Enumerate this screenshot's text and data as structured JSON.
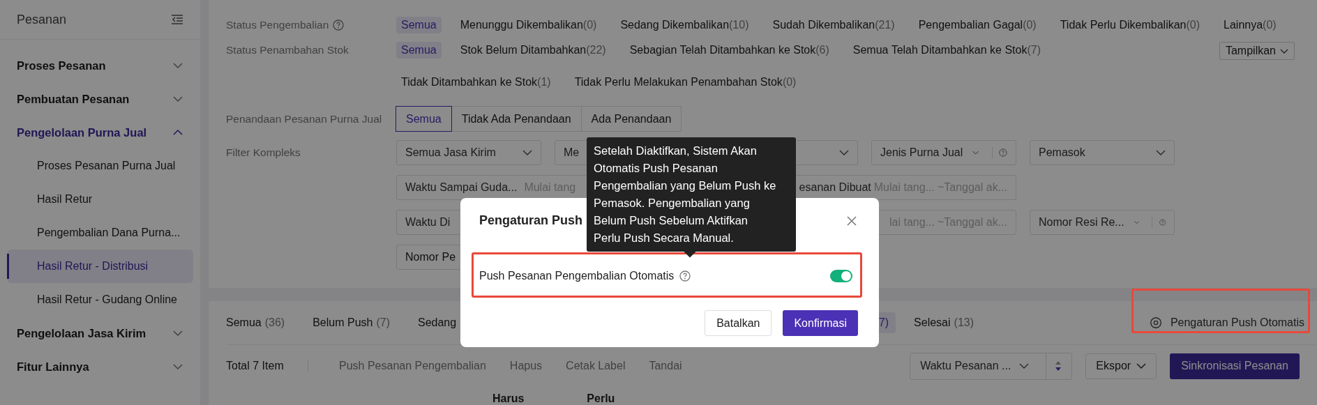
{
  "sidebar": {
    "title": "Pesanan",
    "items": [
      {
        "label": "Proses Pesanan",
        "expanded": false
      },
      {
        "label": "Pembuatan Pesanan",
        "expanded": false
      },
      {
        "label": "Pengelolaan Purna Jual",
        "expanded": true,
        "children": [
          {
            "label": "Proses Pesanan Purna Jual",
            "selected": false
          },
          {
            "label": "Hasil Retur",
            "selected": false
          },
          {
            "label": "Pengembalian Dana Purna...",
            "selected": false
          },
          {
            "label": "Hasil Retur - Distribusi",
            "selected": true
          },
          {
            "label": "Hasil Retur - Gudang Online",
            "selected": false
          }
        ]
      },
      {
        "label": "Pengelolaan Jasa Kirim",
        "expanded": false
      },
      {
        "label": "Fitur Lainnya",
        "expanded": false
      }
    ]
  },
  "filters": {
    "status_pengembalian": {
      "label": "Status Pengembalian",
      "has_help": true,
      "options": [
        {
          "label": "Semua",
          "selected": true
        },
        {
          "label": "Menunggu Dikembalikan",
          "count": "(0)",
          "selected": false
        },
        {
          "label": "Sedang Dikembalikan",
          "count": "(10)",
          "selected": false
        },
        {
          "label": "Sudah Dikembalikan",
          "count": "(21)",
          "selected": false
        },
        {
          "label": "Pengembalian Gagal",
          "count": "(0)",
          "selected": false
        },
        {
          "label": "Tidak Perlu Dikembalikan",
          "count": "(0)",
          "selected": false
        },
        {
          "label": "Lainnya",
          "count": "(0)",
          "selected": false
        }
      ]
    },
    "status_stok": {
      "label": "Status Penambahan Stok",
      "button": "Tampilkan",
      "options": [
        {
          "label": "Semua",
          "selected": true
        },
        {
          "label": "Stok Belum Ditambahkan",
          "count": "(22)",
          "selected": false
        },
        {
          "label": "Sebagian Telah Ditambahkan ke Stok",
          "count": "(6)",
          "selected": false
        },
        {
          "label": "Semua Telah Ditambahkan ke Stok",
          "count": "(7)",
          "selected": false
        },
        {
          "label": "Tidak Ditambahkan ke Stok",
          "count": "(1)",
          "selected": false
        },
        {
          "label": "Tidak Perlu Melakukan Penambahan Stok",
          "count": "(0)",
          "selected": false
        }
      ]
    },
    "penandaan": {
      "label": "Penandaan Pesanan Purna Jual",
      "options": [
        {
          "label": "Semua",
          "selected": true
        },
        {
          "label": "Tidak Ada Penandaan",
          "selected": false
        },
        {
          "label": "Ada Penandaan",
          "selected": false
        }
      ]
    },
    "kompleks": {
      "label": "Filter Kompleks",
      "rows": [
        [
          {
            "kind": "select",
            "label": "Semua Jasa Kirim"
          },
          {
            "kind": "select_partial",
            "label": "Me"
          },
          {
            "kind": "select"
          },
          {
            "kind": "select_help",
            "label": "Jenis Purna Jual"
          },
          {
            "kind": "select",
            "label": "Pemasok"
          }
        ],
        [
          {
            "kind": "range",
            "label": "Waktu Sampai Guda...",
            "start": "Mulai tang"
          },
          {
            "kind": "range_end",
            "label": "esanan Dibuat",
            "start": "Mulai tang...",
            "end": "~Tanggal ak..."
          }
        ],
        [
          {
            "kind": "range",
            "label": "Waktu Di"
          },
          {
            "kind": "range_end",
            "start": "lai tang...",
            "end": "~Tanggal ak..."
          },
          {
            "kind": "select_help",
            "label": "Nomor Resi Re..."
          }
        ],
        [
          {
            "kind": "input",
            "label": "Nomor Pe"
          }
        ]
      ]
    }
  },
  "tabs": [
    {
      "label": "Semua",
      "count": "(36)",
      "selected": false,
      "kind": "full"
    },
    {
      "label": "Belum Push",
      "count": "(7)",
      "selected": false,
      "kind": "full"
    },
    {
      "label": "Sedang",
      "selected": false,
      "kind": "full"
    },
    {
      "count": "7)",
      "selected": true,
      "kind": "fragment"
    },
    {
      "label": "Selesai",
      "count": "(13)",
      "selected": false,
      "kind": "full"
    }
  ],
  "push_settings_link": "Pengaturan Push Otomatis",
  "toolbar": {
    "total": "Total 7 Item",
    "actions": [
      "Push Pesanan Pengembalian",
      "Hapus",
      "Cetak Label",
      "Tandai"
    ],
    "sort": "Waktu Pesanan ...",
    "export": "Ekspor",
    "sync": "Sinkronisasi Pesanan"
  },
  "table": {
    "columns": [
      "Harus",
      "Perlu"
    ]
  },
  "modal": {
    "title": "Pengaturan Push",
    "setting": {
      "label": "Push Pesanan Pengembalian Otomatis",
      "on": true
    },
    "buttons": [
      {
        "label": "Batalkan",
        "kind": "secondary"
      },
      {
        "label": "Konfirmasi",
        "kind": "primary"
      }
    ]
  },
  "tooltip": "Setelah Diaktifkan, Sistem Akan Otomatis Push Pesanan Pengembalian yang Belum Push ke Pemasok. Pengembalian yang Belum Push Sebelum Aktifkan Perlu Push Secara Manual."
}
